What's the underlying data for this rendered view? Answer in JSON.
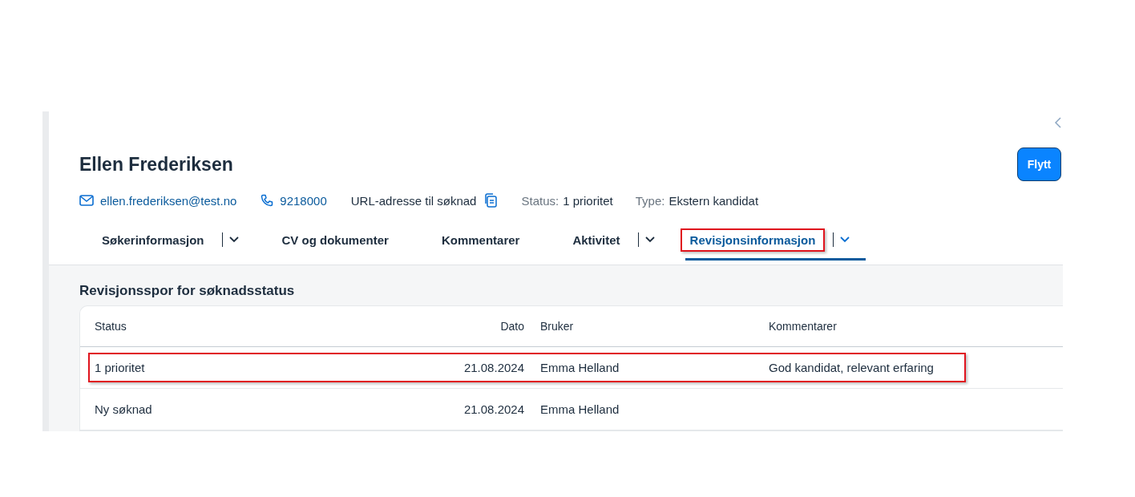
{
  "candidate": {
    "name": "Ellen Frederiksen",
    "email": "ellen.frederiksen@test.no",
    "phone": "9218000",
    "url_label": "URL-adresse til søknad",
    "status_label": "Status:",
    "status_value": "1 prioritet",
    "type_label": "Type:",
    "type_value": "Ekstern kandidat"
  },
  "move_button": "Flytt",
  "tabs": [
    {
      "label": "Søkerinformasjon",
      "selected": false,
      "has_menu": true,
      "highlighted": false
    },
    {
      "label": "CV og dokumenter",
      "selected": false,
      "has_menu": false,
      "highlighted": false
    },
    {
      "label": "Kommentarer",
      "selected": false,
      "has_menu": false,
      "highlighted": false
    },
    {
      "label": "Aktivitet",
      "selected": false,
      "has_menu": true,
      "highlighted": false
    },
    {
      "label": "Revisjonsinformasjon",
      "selected": true,
      "has_menu": true,
      "highlighted": true
    }
  ],
  "section_title": "Revisjonsspor for søknadsstatus",
  "table": {
    "columns": [
      "Status",
      "Dato",
      "Bruker",
      "Kommentarer"
    ],
    "rows": [
      {
        "cells": [
          "1 prioritet",
          "21.08.2024",
          "Emma Helland",
          "God kandidat, relevant erfaring"
        ],
        "highlighted": true
      },
      {
        "cells": [
          "Ny søknad",
          "21.08.2024",
          "Emma Helland",
          ""
        ],
        "highlighted": false
      }
    ]
  }
}
